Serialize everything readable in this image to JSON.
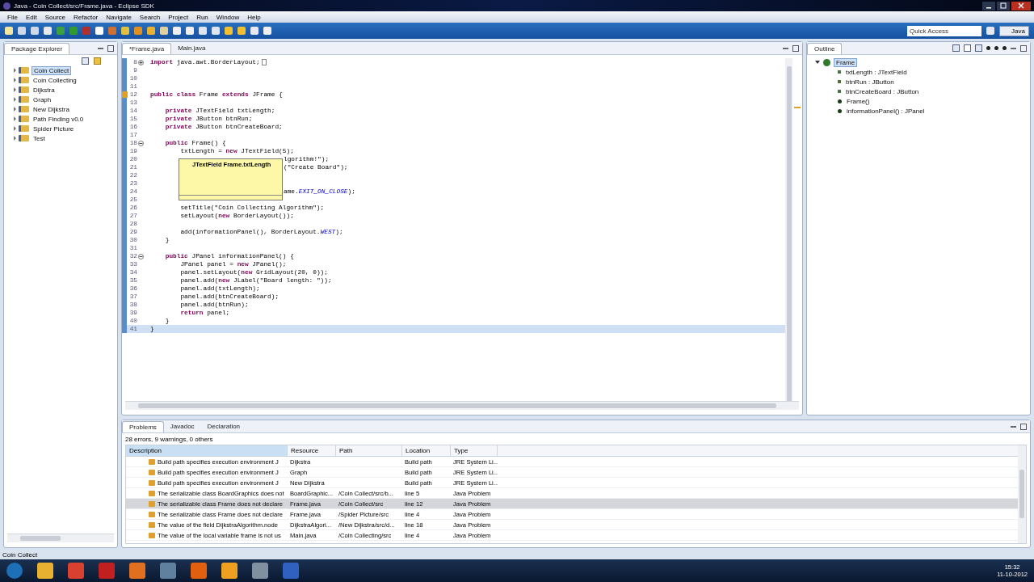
{
  "window": {
    "title": "Java - Coin Collect/src/Frame.java - Eclipse SDK"
  },
  "menu": [
    "File",
    "Edit",
    "Source",
    "Refactor",
    "Navigate",
    "Search",
    "Project",
    "Run",
    "Window",
    "Help"
  ],
  "quick_access": {
    "placeholder": "Quick Access"
  },
  "perspective": {
    "label": "Java",
    "selected": true
  },
  "package_explorer": {
    "title": "Package Explorer",
    "projects": [
      {
        "name": "Coin Collect",
        "selected": true
      },
      {
        "name": "Coin Collecting",
        "selected": false
      },
      {
        "name": "Dijkstra",
        "selected": false
      },
      {
        "name": "Graph",
        "selected": false
      },
      {
        "name": "New Dijkstra",
        "selected": false
      },
      {
        "name": "Path Finding v0.0",
        "selected": false
      },
      {
        "name": "Spider Picture",
        "selected": false
      },
      {
        "name": "Test",
        "selected": false
      }
    ]
  },
  "editor": {
    "tabs": [
      {
        "label": "*Frame.java",
        "selected": true
      },
      {
        "label": "Main.java",
        "selected": false
      }
    ],
    "lines": [
      {
        "number": "8",
        "code": "**import** java.awt.BorderLayout;",
        "fold_collapsed": true
      },
      {
        "number": "9"
      },
      {
        "number": "10"
      },
      {
        "number": "11"
      },
      {
        "number": "12",
        "code": "**public** **class** Frame **extends** JFrame {",
        "warning": true
      },
      {
        "number": "13"
      },
      {
        "number": "14",
        "code": "    **private** JTextField txtLength;"
      },
      {
        "number": "15",
        "code": "    **private** JButton btnRun;"
      },
      {
        "number": "16",
        "code": "    **private** JButton btnCreateBoard;"
      },
      {
        "number": "17"
      },
      {
        "number": "18",
        "code": "    **public** Frame() {",
        "fold_collapsed": false
      },
      {
        "number": "19",
        "code": "        txtLength = **new** JTextField(5);"
      },
      {
        "number": "20",
        "tail": "lgorithm!\");"
      },
      {
        "number": "21",
        "tail": "(\"Create Board\");"
      },
      {
        "number": "22"
      },
      {
        "number": "23"
      },
      {
        "number": "24",
        "tail": "ame.*EXIT_ON_CLOSE*);"
      },
      {
        "number": "25"
      },
      {
        "number": "26",
        "code": "        setTitle(\"Coin Collecting Algorithm\");"
      },
      {
        "number": "27",
        "code": "        setLayout(**new** BorderLayout());"
      },
      {
        "number": "28"
      },
      {
        "number": "29",
        "code": "        add(informationPanel(), BorderLayout.*WEST*);"
      },
      {
        "number": "30",
        "code": "    }"
      },
      {
        "number": "31"
      },
      {
        "number": "32",
        "code": "    **public** JPanel informationPanel() {",
        "fold_collapsed": false
      },
      {
        "number": "33",
        "code": "        JPanel panel = **new** JPanel();"
      },
      {
        "number": "34",
        "code": "        panel.setLayout(**new** GridLayout(20, 0));"
      },
      {
        "number": "35",
        "code": "        panel.add(**new** JLabel(\"Board length: \"));"
      },
      {
        "number": "36",
        "code": "        panel.add(txtLength);"
      },
      {
        "number": "37",
        "code": "        panel.add(btnCreateBoard);"
      },
      {
        "number": "38",
        "code": "        panel.add(btnRun);"
      },
      {
        "number": "39",
        "code": "        **return** panel;"
      },
      {
        "number": "40",
        "code": "    }"
      },
      {
        "number": "41",
        "code": "}",
        "current": true
      }
    ],
    "tooltip": {
      "text": "JTextField Frame.txtLength"
    }
  },
  "outline": {
    "title": "Outline",
    "root": {
      "label": "Frame",
      "children": [
        {
          "label": "txtLength : JTextField",
          "kind": "field"
        },
        {
          "label": "btnRun : JButton",
          "kind": "field"
        },
        {
          "label": "btnCreateBoard : JButton",
          "kind": "field"
        },
        {
          "label": "Frame()",
          "kind": "constructor"
        },
        {
          "label": "informationPanel() : JPanel",
          "kind": "method"
        }
      ]
    }
  },
  "problems": {
    "tabs": [
      {
        "label": "Problems",
        "selected": true
      },
      {
        "label": "Javadoc",
        "selected": false
      },
      {
        "label": "Declaration",
        "selected": false
      }
    ],
    "summary": "28 errors, 9 warnings, 0 others",
    "columns": [
      "Description",
      "Resource",
      "Path",
      "Location",
      "Type"
    ],
    "rows": [
      {
        "cells": [
          "Build path specifies execution environment J",
          "Dijkstra",
          "",
          "Build path",
          "JRE System Li..."
        ],
        "selected": false
      },
      {
        "cells": [
          "Build path specifies execution environment J",
          "Graph",
          "",
          "Build path",
          "JRE System Li..."
        ],
        "selected": false
      },
      {
        "cells": [
          "Build path specifies execution environment J",
          "New Dijkstra",
          "",
          "Build path",
          "JRE System Li..."
        ],
        "selected": false
      },
      {
        "cells": [
          "The serializable class BoardGraphics does not",
          "BoardGraphic...",
          "/Coin Collect/src/b...",
          "line 5",
          "Java Problem"
        ],
        "selected": false
      },
      {
        "cells": [
          "The serializable class Frame does not declare",
          "Frame.java",
          "/Coin Collect/src",
          "line 12",
          "Java Problem"
        ],
        "selected": true
      },
      {
        "cells": [
          "The serializable class Frame does not declare",
          "Frame.java",
          "/Spider Picture/src",
          "line 4",
          "Java Problem"
        ],
        "selected": false
      },
      {
        "cells": [
          "The value of the field DijkstraAlgorithm.node",
          "DijkstraAlgori...",
          "/New Dijkstra/src/d...",
          "line 18",
          "Java Problem"
        ],
        "selected": false
      },
      {
        "cells": [
          "The value of the local variable frame is not us",
          "Main.java",
          "/Coin Collecting/src",
          "line 4",
          "Java Problem"
        ],
        "selected": false
      }
    ]
  },
  "status_bar": "Coin Collect",
  "clock": {
    "time": "15:32",
    "date": "11-10-2012"
  }
}
